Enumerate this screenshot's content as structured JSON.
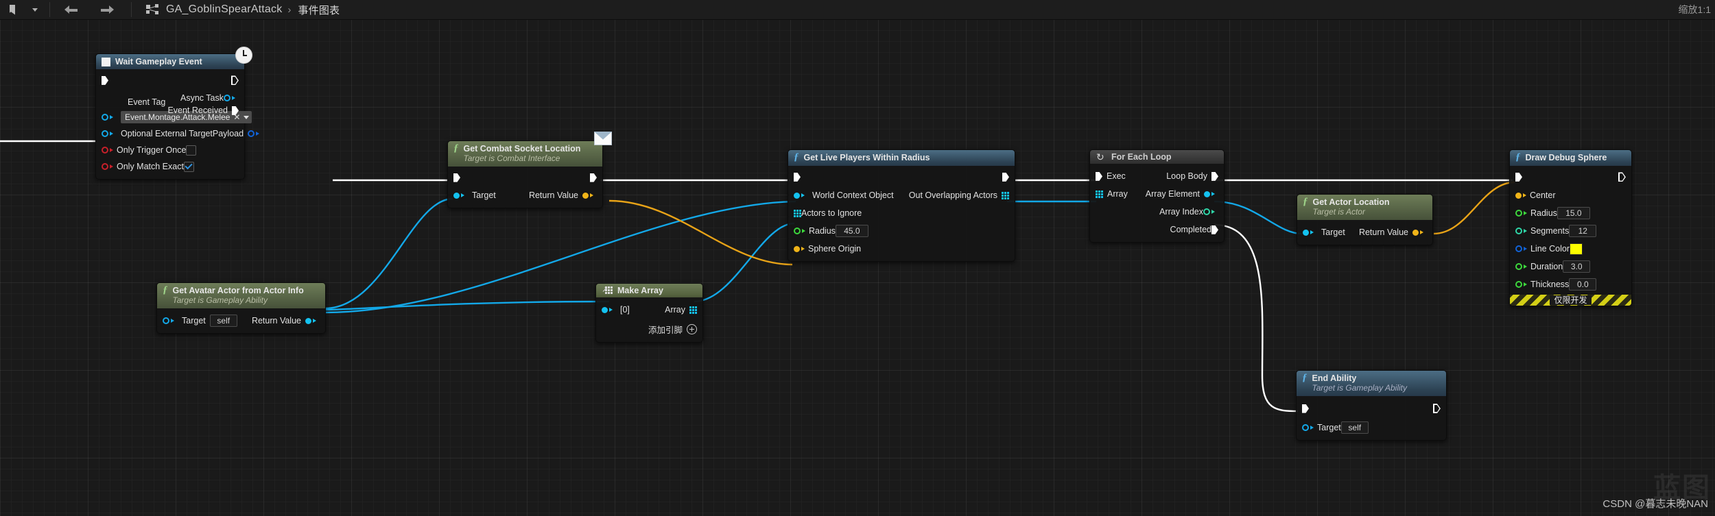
{
  "toolbar": {
    "bookmark_icon": "bookmark-icon",
    "dropdown_icon": "chevron-down-icon",
    "back_icon": "back-arrow-icon",
    "forward_icon": "forward-arrow-icon",
    "graph_icon": "blueprint-graph-icon",
    "breadcrumb_asset": "GA_GoblinSpearAttack",
    "breadcrumb_separator": "›",
    "breadcrumb_tab": "事件图表",
    "zoom_label": "缩放1:1"
  },
  "nodes": {
    "wait_gameplay_event": {
      "title": "Wait Gameplay Event",
      "badge": "clock-badge",
      "inputs": {
        "event_tag_label": "Event Tag",
        "event_tag_value": "Event.Montage.Attack.Melee",
        "optional_external_target": "Optional External Target",
        "only_trigger_once": "Only Trigger Once",
        "only_trigger_once_checked": false,
        "only_match_exact": "Only Match Exact",
        "only_match_exact_checked": true
      },
      "outputs": {
        "async_task": "Async Task",
        "event_received": "Event Received",
        "payload": "Payload"
      }
    },
    "get_combat_socket_location": {
      "title": "Get Combat Socket Location",
      "subtitle": "Target is Combat Interface",
      "badge": "message-envelope-badge",
      "input_target": "Target",
      "output_return_value": "Return Value"
    },
    "get_avatar_actor": {
      "title": "Get Avatar Actor from Actor Info",
      "subtitle": "Target is Gameplay Ability",
      "input_target": "Target",
      "input_target_value": "self",
      "output_return_value": "Return Value"
    },
    "make_array": {
      "title": "Make Array",
      "input_index": "[0]",
      "output_array": "Array",
      "add_pin_label": "添加引脚"
    },
    "get_live_players": {
      "title": "Get Live Players Within Radius",
      "inputs": {
        "world_context_object": "World Context Object",
        "actors_to_ignore": "Actors to Ignore",
        "radius": "Radius",
        "radius_value": "45.0",
        "sphere_origin": "Sphere Origin"
      },
      "outputs": {
        "out_overlapping_actors": "Out Overlapping Actors"
      }
    },
    "for_each_loop": {
      "title": "For Each Loop",
      "inputs": {
        "exec": "Exec",
        "array": "Array"
      },
      "outputs": {
        "loop_body": "Loop Body",
        "array_element": "Array Element",
        "array_index": "Array Index",
        "completed": "Completed"
      }
    },
    "get_actor_location": {
      "title": "Get Actor Location",
      "subtitle": "Target is Actor",
      "input_target": "Target",
      "output_return_value": "Return Value"
    },
    "draw_debug_sphere": {
      "title": "Draw Debug Sphere",
      "inputs": {
        "center": "Center",
        "radius": "Radius",
        "radius_value": "15.0",
        "segments": "Segments",
        "segments_value": "12",
        "line_color": "Line Color",
        "line_color_value": "#ffff00",
        "duration": "Duration",
        "duration_value": "3.0",
        "thickness": "Thickness",
        "thickness_value": "0.0"
      },
      "dev_only_banner": "仅限开发"
    },
    "end_ability": {
      "title": "End Ability",
      "subtitle": "Target is Gameplay Ability",
      "input_target": "Target",
      "input_target_value": "self"
    }
  },
  "watermark": {
    "logo": "蓝图",
    "credit": "CSDN @暮志未晚NAN"
  }
}
